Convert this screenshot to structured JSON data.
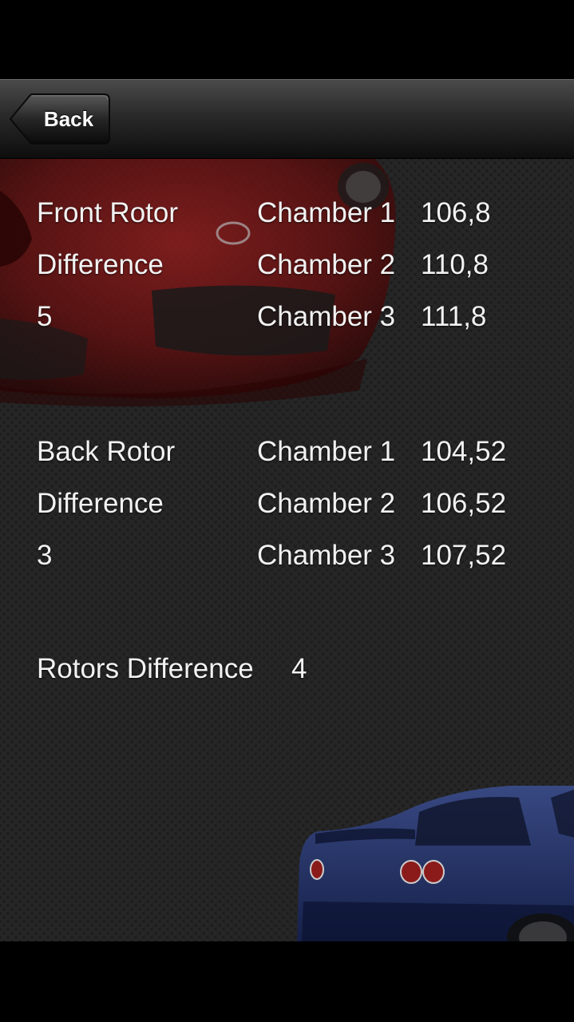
{
  "nav": {
    "back_label": "Back"
  },
  "front_rotor": {
    "title": "Front Rotor",
    "difference_label": "Difference",
    "difference_value": "5",
    "chambers": [
      {
        "label": "Chamber 1",
        "value": "106,8"
      },
      {
        "label": "Chamber 2",
        "value": "110,8"
      },
      {
        "label": "Chamber 3",
        "value": "111,8"
      }
    ]
  },
  "back_rotor": {
    "title": "Back Rotor",
    "difference_label": "Difference",
    "difference_value": "3",
    "chambers": [
      {
        "label": "Chamber 1",
        "value": "104,52"
      },
      {
        "label": "Chamber 2",
        "value": "106,52"
      },
      {
        "label": "Chamber 3",
        "value": "107,52"
      }
    ]
  },
  "rotors_difference": {
    "label": "Rotors Difference",
    "value": "4"
  },
  "colors": {
    "background": "#1c1c1c",
    "text": "#f2f2f2",
    "red_car": "#7a1414",
    "blue_car": "#1f2f6e"
  },
  "icons": {
    "back": "back-arrow-button-shape"
  }
}
